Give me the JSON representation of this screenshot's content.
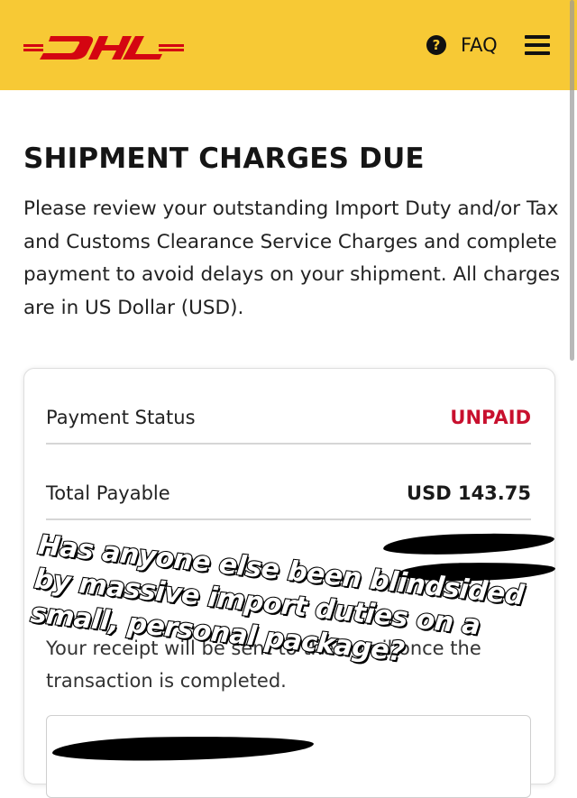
{
  "header": {
    "logo_text": "DHL",
    "faq_label": "FAQ",
    "help_icon": "question-circle-icon",
    "menu_icon": "hamburger-menu-icon",
    "background_color": "#f7c935",
    "brand_color": "#d40511"
  },
  "page": {
    "title": "SHIPMENT CHARGES DUE",
    "intro": "Please review your outstanding Import Duty and/or Tax and Customs Clearance Service Charges and complete payment to avoid delays on your shipment. All charges are in US Dollar (USD)."
  },
  "card": {
    "payment_status_label": "Payment Status",
    "payment_status_value": "UNPAID",
    "payment_status_color": "#c8102e",
    "total_payable_label": "Total Payable",
    "total_payable_value": "USD 143.75",
    "receipt_note": "Your receipt will be sent to the email once the transaction is completed."
  },
  "overlay": {
    "caption": "Has anyone else been blindsided by massive import duties on a small, personal package?"
  }
}
